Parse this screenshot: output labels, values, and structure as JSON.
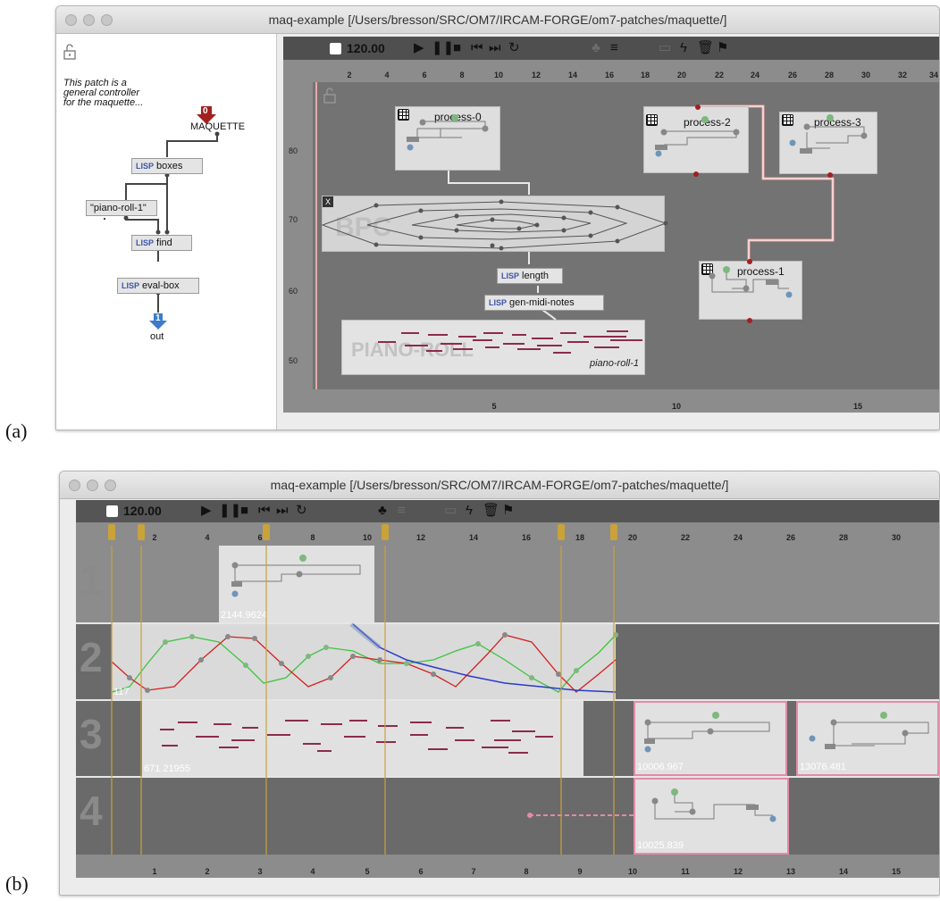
{
  "figure_labels": {
    "a": "(a)",
    "b": "(b)"
  },
  "window_a": {
    "title": "maq-example  [/Users/bresson/SRC/OM7/IRCAM-FORGE/om7-patches/maquette/]",
    "lock_icon": "open-padlock-icon",
    "comment": [
      "This patch is a",
      "general controller",
      "for the maquette..."
    ],
    "maquette_input": {
      "index": "0",
      "label": "MAQUETTE"
    },
    "boxes": {
      "lisp": "LISP",
      "boxes": "boxes",
      "find": "find",
      "eval_box": "eval-box",
      "piano_roll_string": "\"piano-roll-1\""
    },
    "output": {
      "index": "1",
      "label": "out"
    },
    "tempo": "120.00",
    "ruler_ticks": [
      "2",
      "4",
      "6",
      "8",
      "10",
      "12",
      "14",
      "16",
      "18",
      "20",
      "22",
      "24",
      "26",
      "28",
      "30",
      "32",
      "34"
    ],
    "y_ticks": [
      "80",
      "70",
      "60",
      "50"
    ],
    "bottom_ticks": [
      "5",
      "10",
      "15"
    ],
    "process_labels": {
      "p0": "process-0",
      "p1": "process-1",
      "p2": "process-2",
      "p3": "process-3"
    },
    "bpf_label": "BPC",
    "piano_roll": {
      "title": "PIANO-ROLL",
      "name": "piano-roll-1"
    },
    "length_box": "length",
    "gen_midi_box": "gen-midi-notes",
    "x_icon": "X"
  },
  "window_b": {
    "title": "maq-example  [/Users/bresson/SRC/OM7/IRCAM-FORGE/om7-patches/maquette/]",
    "tempo": "120.00",
    "ruler_ticks": [
      "2",
      "4",
      "6",
      "8",
      "10",
      "12",
      "14",
      "16",
      "18",
      "20",
      "22",
      "24",
      "26",
      "28",
      "30"
    ],
    "bottom_ticks": [
      "1",
      "2",
      "3",
      "4",
      "5",
      "6",
      "7",
      "8",
      "9",
      "10",
      "11",
      "12",
      "13",
      "14",
      "15"
    ],
    "track_numbers": [
      "1",
      "2",
      "3",
      "4"
    ],
    "clip_values": {
      "t1": "2144.9624",
      "t2": "117",
      "t3a": "671.21955",
      "t3b": "10006.967",
      "t3c": "13076.481",
      "t4": "10025.839"
    }
  },
  "toolbar_icons": [
    "play-icon",
    "pause-icon",
    "stop-icon",
    "skip-back-icon",
    "skip-forward-icon",
    "loop-icon",
    "tree-icon",
    "list-icon",
    "comment-icon",
    "lightning-icon",
    "trash-icon",
    "paint-icon"
  ],
  "colors": {
    "toolbar": "#4a4a4a",
    "canvas": "#6e6e6e",
    "marker": "#c9a23a",
    "pink": "#e48aa8",
    "note": "#8b2b4e",
    "curve_red": "#d42020",
    "curve_green": "#3cc43c",
    "curve_blue": "#2a3ac8",
    "input_red": "#a32020",
    "output_blue": "#3d7cc8"
  }
}
